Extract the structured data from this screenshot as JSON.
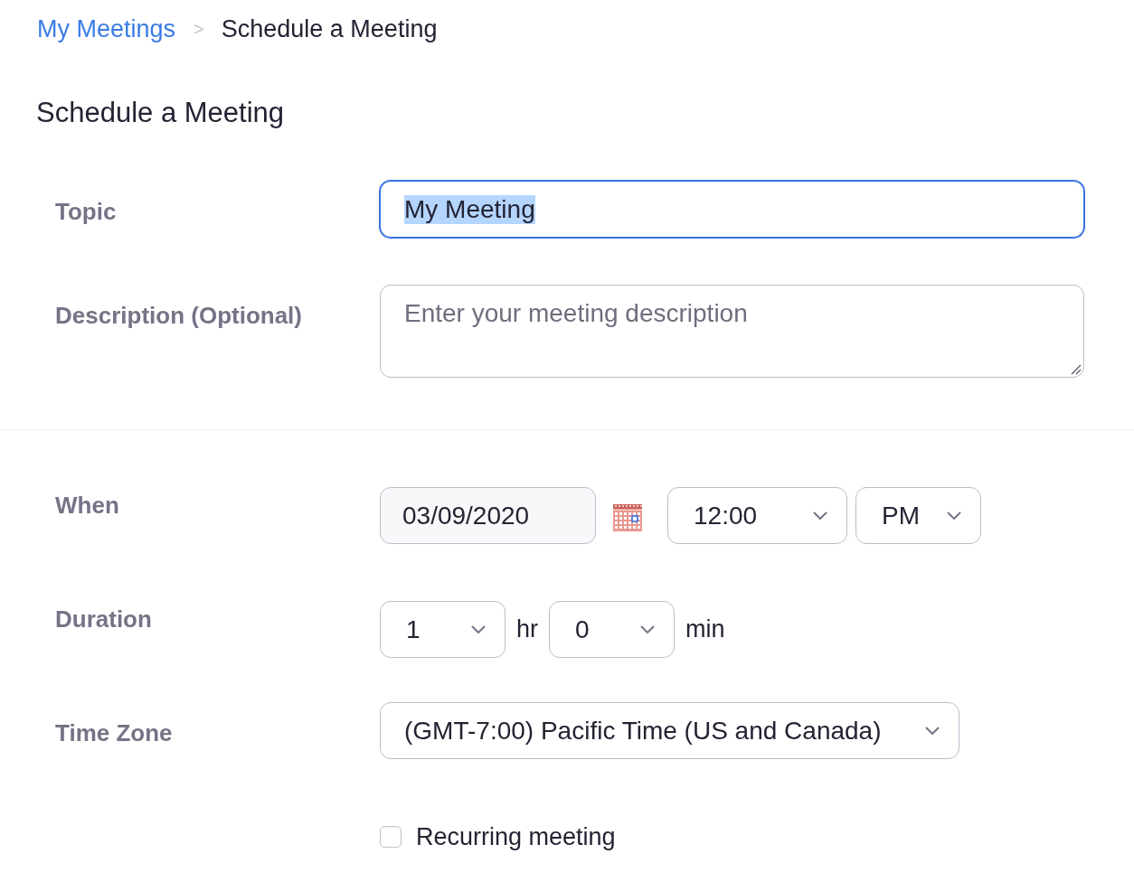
{
  "breadcrumb": {
    "items": [
      {
        "label": "My Meetings",
        "kind": "link"
      },
      {
        "label": "Schedule a Meeting",
        "kind": "current"
      }
    ],
    "separator": ">"
  },
  "title": "Schedule a Meeting",
  "sections": [
    {
      "fields": [
        {
          "kind": "text",
          "label": "Topic",
          "value": "My Meeting",
          "focused": true,
          "text_selected": true
        },
        {
          "kind": "textarea",
          "label": "Description (Optional)",
          "placeholder": "Enter your meeting description"
        }
      ]
    },
    {
      "fields": [
        {
          "kind": "datetime",
          "label": "When",
          "date": "03/09/2020",
          "time": "12:00",
          "period": "PM"
        },
        {
          "kind": "duration",
          "label": "Duration",
          "hours": "1",
          "hours_unit": "hr",
          "minutes": "0",
          "minutes_unit": "min"
        },
        {
          "kind": "select",
          "label": "Time Zone",
          "value": "(GMT-7:00) Pacific Time (US and Canada)"
        },
        {
          "kind": "checkbox",
          "label": "Recurring meeting",
          "checked": false
        }
      ]
    }
  ]
}
